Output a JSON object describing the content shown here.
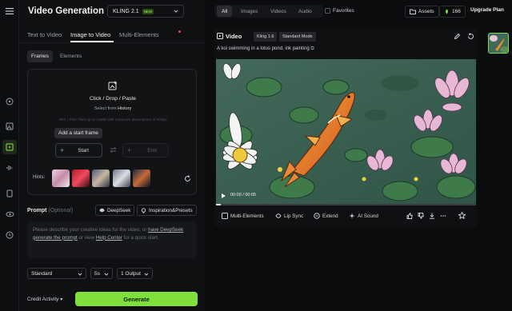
{
  "header": {
    "title": "Video Generation",
    "model": "KLING 2.1",
    "model_badge": "NEW"
  },
  "tabs": [
    "Text to Video",
    "Image to Video",
    "Multi-Elements"
  ],
  "modes": [
    "Frames",
    "Elements"
  ],
  "upload": {
    "title": "Click / Drop / Paste",
    "select_prefix": "Select from",
    "select_link": "History",
    "requirements": "JPG / PNG files up to 10MB with minimum dimensions of 300px",
    "tooltip": "Add a start frame",
    "start_label": "Start",
    "end_label": "End",
    "hints_label": "Hints:"
  },
  "prompt": {
    "label": "Prompt",
    "optional": "(Optional)",
    "deepseek": "DeepSeek",
    "presets": "Inspiration&Presets",
    "placeholder_1": "Please describe your creative ideas for the video, or",
    "placeholder_link_1": "have DeepSeek",
    "placeholder_link_2": "generate the prompt",
    "placeholder_2": "or view",
    "placeholder_link_3": "Help Center",
    "placeholder_3": "for a quick start."
  },
  "settings": {
    "mode": "Standard",
    "duration": "5s",
    "outputs": "1 Output"
  },
  "footer": {
    "credit": "Credit Activity",
    "generate": "Generate"
  },
  "filters": [
    "All",
    "Images",
    "Videos",
    "Audio"
  ],
  "favorites": "Favorites",
  "assets": "Assets",
  "credits": "166",
  "upgrade": "Upgrade Plan",
  "result": {
    "heading": "Video",
    "model_tag": "Kling 1.6",
    "mode_tag": "Standard Mode",
    "prompt_text": "A koi swimming in a lotus pond, ink painting",
    "time": "00:00 / 00:05"
  },
  "actions": [
    "Multi-Elements",
    "Lip Sync",
    "Extend",
    "AI Sound"
  ],
  "colors": {
    "accent": "#7fe03d",
    "background": "#0d0e10"
  }
}
